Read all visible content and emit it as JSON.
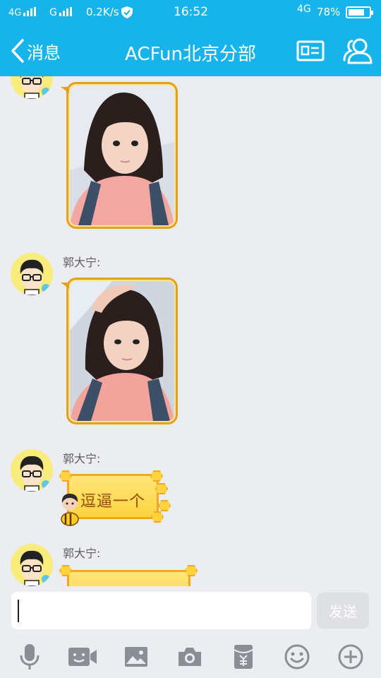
{
  "status_bar": {
    "network1": "4G",
    "network2": "G",
    "speed": "0.2K/s",
    "time": "16:52",
    "network3": "4G",
    "battery_text": "78%",
    "battery_level": 0.78
  },
  "header": {
    "back_label": "消息",
    "title": "ACFun北京分部"
  },
  "messages": [
    {
      "type": "image",
      "sender": ""
    },
    {
      "type": "image",
      "sender": "郭大宁:"
    },
    {
      "type": "sticker_text",
      "sender": "郭大宁:",
      "text": "逗逼一个"
    },
    {
      "type": "sticker_text",
      "sender": "郭大宁:",
      "text": ""
    }
  ],
  "composer": {
    "value": "",
    "send_label": "发送"
  },
  "toolbar_icons": [
    "microphone-icon",
    "video-call-icon",
    "picture-icon",
    "camera-icon",
    "red-packet-icon",
    "emoji-icon",
    "plus-icon"
  ],
  "colors": {
    "header_blue": "#16b4ea",
    "background": "#ebedf0",
    "bubble_border": "#e3a21b",
    "honey_fill": "#ffd23e",
    "icon_gray": "#8a8f96"
  }
}
